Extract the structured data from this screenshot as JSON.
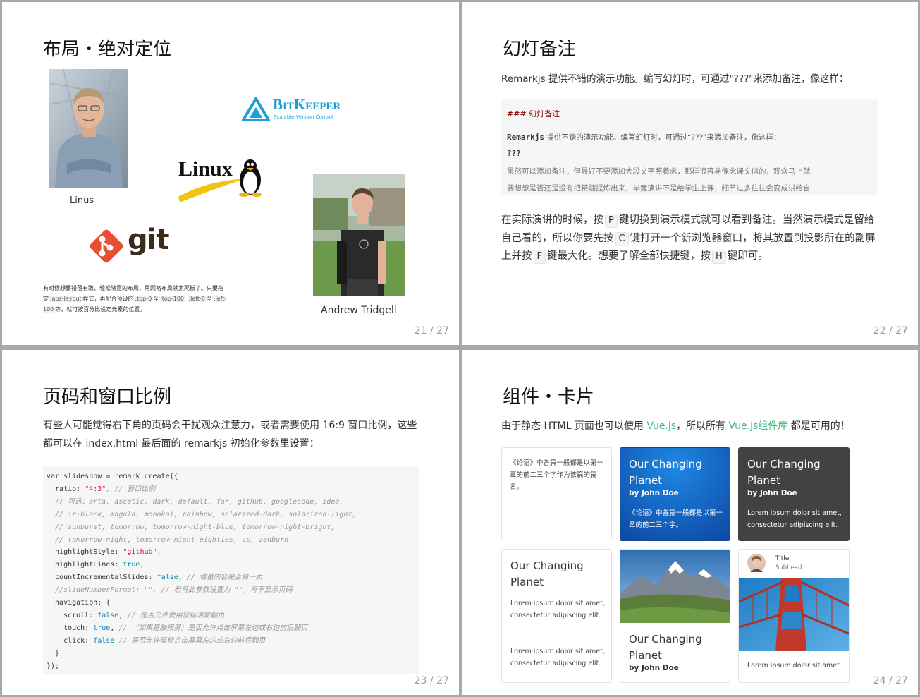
{
  "slide21": {
    "title": "布局・绝对定位",
    "linus_caption": "Linus",
    "bitkeeper_name": "BitKeeper",
    "bitkeeper_tagline": "Scalable Version Control",
    "linux_logo": "Linux",
    "git_logo": "git",
    "andrew_caption": "Andrew Tridgell",
    "text_1": "有时候想要错落有致、轻松随意的布局，用网格布局就太死板了。只要指定",
    "code_abs": ".abs-layout",
    "text_2": "样式，再配合预设的",
    "code_top0": ".top-0",
    "text_3": "至",
    "code_top100": ".top-100",
    "code_left0": ".left-0",
    "text_4": "至",
    "code_left100": ".left-100",
    "text_5": "等，就可按百分比设定元素的位置。",
    "page": "21 / 27"
  },
  "slide22": {
    "title": "幻灯备注",
    "intro": "Remarkjs 提供不错的演示功能。编写幻灯时，可通过\"???\"来添加备注，像这样：",
    "code_heading": "### 幻灯备注",
    "code_line1_bold": "Remarkjs",
    "code_line1_rest": " 提供不错的演示功能。编写幻灯时，可通过“???”来添加备注，像这样：",
    "code_line2": "???",
    "code_line3": "虽然可以添加备注，但最好不要添加大段文字照着念，那样很容易像念课文似的，观众马上就",
    "code_line4": "要想想是否还是没有把精髓提炼出来，毕竟演讲不是给学生上课，细节过多往往会变成讲给自",
    "body_1": "在实际演讲的时候，按",
    "key_p": "P",
    "body_2": "键切换到演示模式就可以看到备注。当然演示模式是留给自己看的，所以你要先按",
    "key_c": "C",
    "body_3": "键打开一个新浏览器窗口，将其放置到投影所在的副屏上并按",
    "key_f": "F",
    "body_4": "键最大化。想要了解全部快捷键，按",
    "key_h": "H",
    "body_5": "键即可。",
    "page": "22 / 27"
  },
  "slide23": {
    "title": "页码和窗口比例",
    "intro": "有些人可能觉得右下角的页码会干扰观众注意力，或者需要使用 16:9 窗口比例，这些都可以在 index.html 最后面的 remarkjs 初始化参数里设置：",
    "c1": "var slideshow = remark.create({",
    "c2_a": "  ratio: ",
    "c2_str": "\"4:3\"",
    "c2_cm": ", // 窗口比例",
    "c3": "  // 可选：arta, ascetic, dark, default, far, github, googlecode, idea,",
    "c4": "  // ir-black, magula, monokai, rainbow, solarized-dark, solarized-light,",
    "c5": "  // sunburst, tomorrow, tomorrow-night-blue, tomorrow-night-bright,",
    "c6": "  // tomorrow-night, tomorrow-night-eighties, vs, zenburn.",
    "c7_a": "  highlightStyle: ",
    "c7_str": "\"github\"",
    "c7_b": ",",
    "c8_a": "  highlightLines: ",
    "c8_kw": "true",
    "c8_b": ",",
    "c9_a": "  countIncrementalSlides: ",
    "c9_kw": "false",
    "c9_b": ", ",
    "c9_cm": "// 增量内容是否算一页",
    "c10": "  //slideNumberFormat: \"\", // 若将此参数设置为 \"\"，将不显示页码",
    "c11": "  navigation: {",
    "c12_a": "    scroll: ",
    "c12_kw": "false",
    "c12_b": ", ",
    "c12_cm": "// 是否允许使用鼠标滚轮翻页",
    "c13_a": "    touch: ",
    "c13_kw": "true",
    "c13_b": ", ",
    "c13_cm": "// （如果是触摸屏）是否允许点击屏幕左边或右边前后翻页",
    "c14_a": "    click: ",
    "c14_kw": "false",
    "c14_b": " ",
    "c14_cm": "// 是否允许鼠标点击屏幕左边或右边前后翻页",
    "c15": "  }",
    "c16": "});",
    "page": "23 / 27"
  },
  "slide24": {
    "title": "组件・卡片",
    "intro_1": "由于静态 HTML 页面也可以使用 ",
    "link_vue": "Vue.js",
    "intro_2": "，所以所有 ",
    "link_lib": "Vue.js组件库",
    "intro_3": " 都是可用的！",
    "card1_text": "《论语》中各篇一般都是以第一章的前二三个字作为该篇的篇名。",
    "card2_title": "Our Changing Planet",
    "card2_by": "by John Doe",
    "card2_text": "《论语》中各篇一般都是以第一章的前二三个字。",
    "card3_title": "Our Changing Planet",
    "card3_by": "by John Doe",
    "card3_text": "Lorem ipsum dolor sit amet, consectetur adipiscing elit.",
    "card4_title": "Our Changing Planet",
    "card4_text1": "Lorem ipsum dolor sit amet, consectetur adipiscing elit.",
    "card4_text2": "Lorem ipsum dolor sit amet, consectetur adipiscing elit.",
    "card5_title": "Our Changing Planet",
    "card5_by": "by John Doe",
    "card6_title": "Title",
    "card6_sub": "Subhead",
    "card6_text": "Lorem ipsum dolor sit amet.",
    "page": "24 / 27"
  },
  "colors": {
    "accent_link": "#42b983",
    "card_blue": "#1565c0",
    "card_dark": "#424242"
  }
}
